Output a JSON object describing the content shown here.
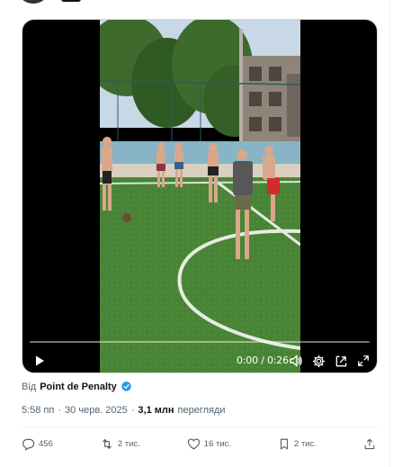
{
  "video": {
    "time": "0:00 / 0:26",
    "progress": 0,
    "controls": {
      "play": "play-icon",
      "volume": "volume-icon",
      "settings": "gear-icon",
      "pip": "picture-in-picture-icon",
      "fullscreen": "expand-icon"
    }
  },
  "attribution": {
    "prefix": "Від",
    "author": "Point de Penalty",
    "verified": true
  },
  "meta": {
    "time": "5:58 пп",
    "separator": "·",
    "date": "30 черв. 2025",
    "separator2": "·",
    "views_count": "3,1 млн",
    "views_label": "перегляди"
  },
  "actions": {
    "replies": "456",
    "reposts": "2 тис.",
    "likes": "16 тис.",
    "bookmarks": "2 тис."
  },
  "colors": {
    "accent": "#1d9bf0",
    "text_secondary": "#536471",
    "text_primary": "#0f1419"
  }
}
